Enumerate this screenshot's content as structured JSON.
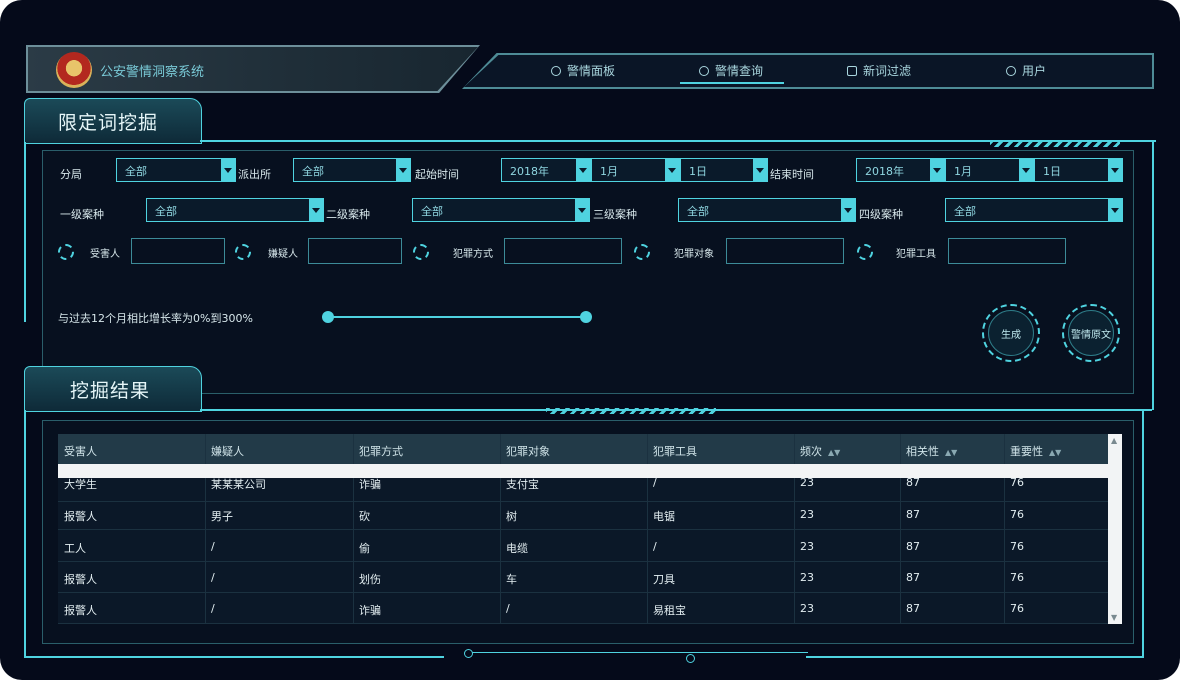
{
  "app": {
    "title": "公安警情洞察系统"
  },
  "nav": {
    "items": [
      {
        "label": "警情面板"
      },
      {
        "label": "警情查询"
      },
      {
        "label": "新词过滤"
      },
      {
        "label": "用户"
      }
    ]
  },
  "sections": {
    "filter_title": "限定词挖掘",
    "results_title": "挖掘结果"
  },
  "filters": {
    "branch_label": "分局",
    "branch_value": "全部",
    "station_label": "派出所",
    "station_value": "全部",
    "start_label": "起始时间",
    "start_year": "2018年",
    "start_month": "1月",
    "start_day": "1日",
    "end_label": "结束时间",
    "end_year": "2018年",
    "end_month": "1月",
    "end_day": "1日",
    "case1_label": "一级案种",
    "case1_value": "全部",
    "case2_label": "二级案种",
    "case2_value": "全部",
    "case3_label": "三级案种",
    "case3_value": "全部",
    "case4_label": "四级案种",
    "case4_value": "全部",
    "victim_label": "受害人",
    "suspect_label": "嫌疑人",
    "method_label": "犯罪方式",
    "target_label": "犯罪对象",
    "tool_label": "犯罪工具",
    "growth_label": "与过去12个月相比增长率为0%到300%",
    "generate_button": "生成",
    "original_button": "警情原文"
  },
  "table": {
    "headers": [
      "受害人",
      "嫌疑人",
      "犯罪方式",
      "犯罪对象",
      "犯罪工具",
      "频次",
      "相关性",
      "重要性"
    ],
    "rows": [
      [
        "大学生",
        "某某某公司",
        "诈骗",
        "支付宝",
        "/",
        "23",
        "87",
        "76"
      ],
      [
        "报警人",
        "男子",
        "砍",
        "树",
        "电锯",
        "23",
        "87",
        "76"
      ],
      [
        "工人",
        "/",
        "偷",
        "电缆",
        "/",
        "23",
        "87",
        "76"
      ],
      [
        "报警人",
        "/",
        "划伤",
        "车",
        "刀具",
        "23",
        "87",
        "76"
      ],
      [
        "报警人",
        "/",
        "诈骗",
        "/",
        "易租宝",
        "23",
        "87",
        "76"
      ]
    ]
  },
  "colors": {
    "accent": "#4fd3e0",
    "background": "#050a1a"
  }
}
